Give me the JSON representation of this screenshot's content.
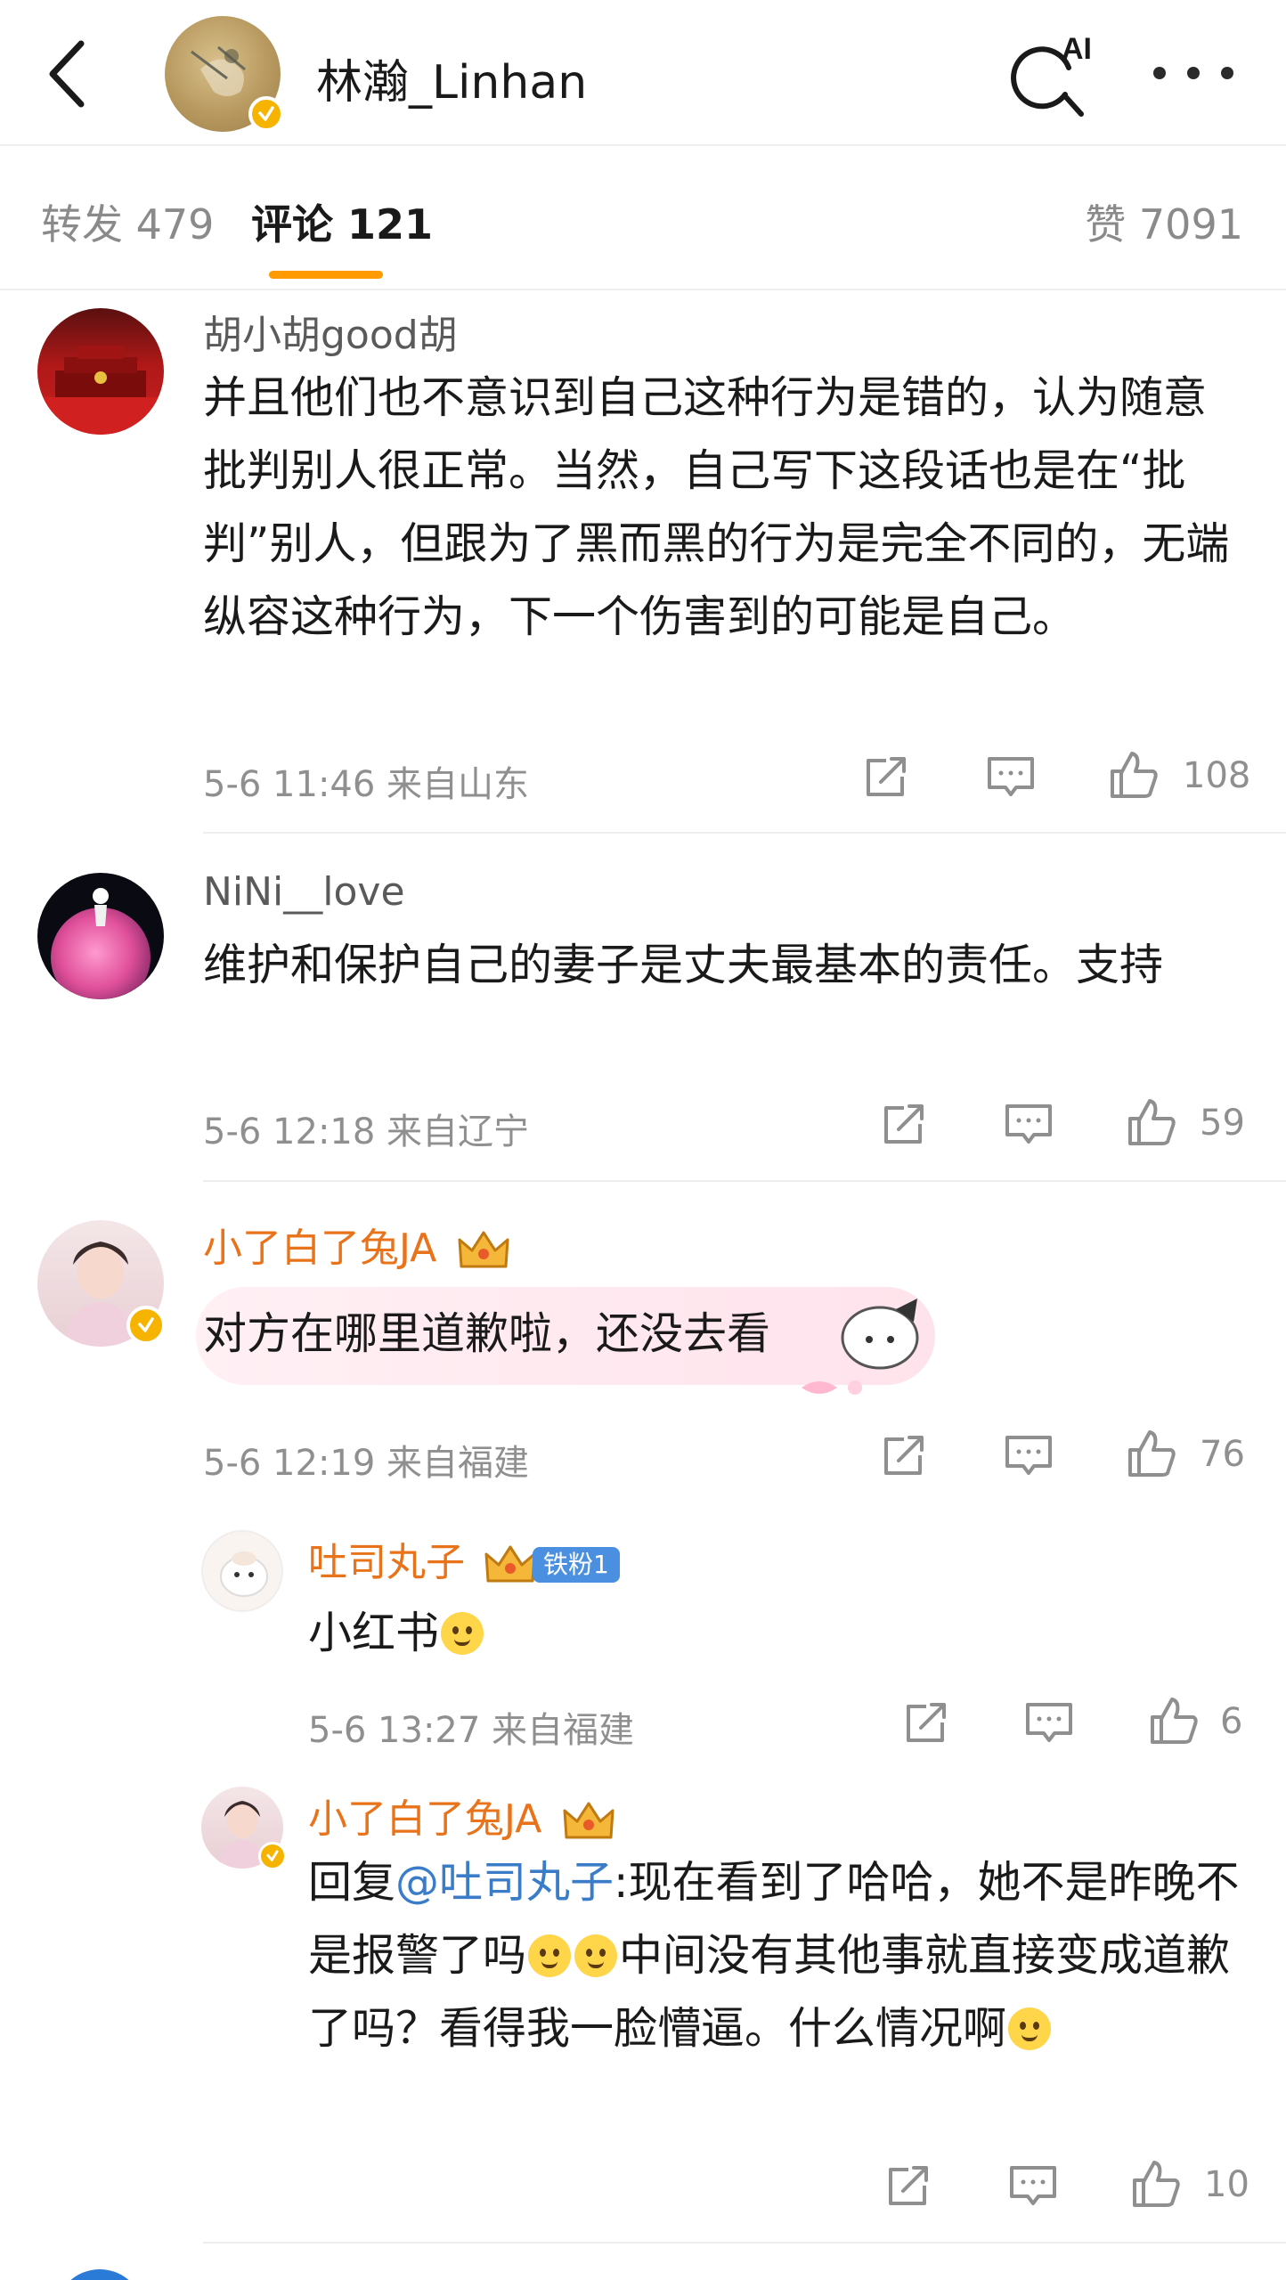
{
  "header": {
    "title": "林瀚_Linhan",
    "ai_label": "AI"
  },
  "tabs": [
    {
      "label": "转发 479"
    },
    {
      "label": "评论 121"
    },
    {
      "label": "赞 7091"
    }
  ],
  "comments": [
    {
      "name": "胡小胡good胡",
      "text": "并且他们也不意识到自己这种行为是错的，认为随意批判别人很正常。当然，自己写下这段话也是在“批判”别人，但跟为了黑而黑的行为是完全不同的，无端纵容这种行为，下一个伤害到的可能是自己。",
      "meta": "5-6 11:46  来自山东",
      "likes": "108"
    },
    {
      "name": "NiNi__love",
      "text": "维护和保护自己的妻子是丈夫最基本的责任。支持",
      "meta": "5-6 12:18  来自辽宁",
      "likes": "59"
    },
    {
      "name": "小了白了兔JA",
      "text": "对方在哪里道歉啦，还没去看",
      "meta": "5-6 12:19  来自福建",
      "likes": "76"
    }
  ],
  "replies": [
    {
      "name": "吐司丸子",
      "fan_badge": "铁粉1",
      "text": "小红书",
      "meta": "5-6 13:27  来自福建",
      "likes": "6"
    },
    {
      "name": "小了白了兔JA",
      "reply_prefix": "回复",
      "mention": "@吐司丸子",
      "text_a": ":现在看到了哈哈，她不是昨晚不是报警了吗",
      "text_b": "中间没有其他事就直接变成道歉了吗？看得我一脸懵逼。什么情况啊",
      "likes": "10"
    }
  ],
  "colors": {
    "accent": "#ff9a00",
    "vip_name": "#e8731b",
    "mention": "#3a7cc8",
    "muted": "#8f8f8f"
  }
}
